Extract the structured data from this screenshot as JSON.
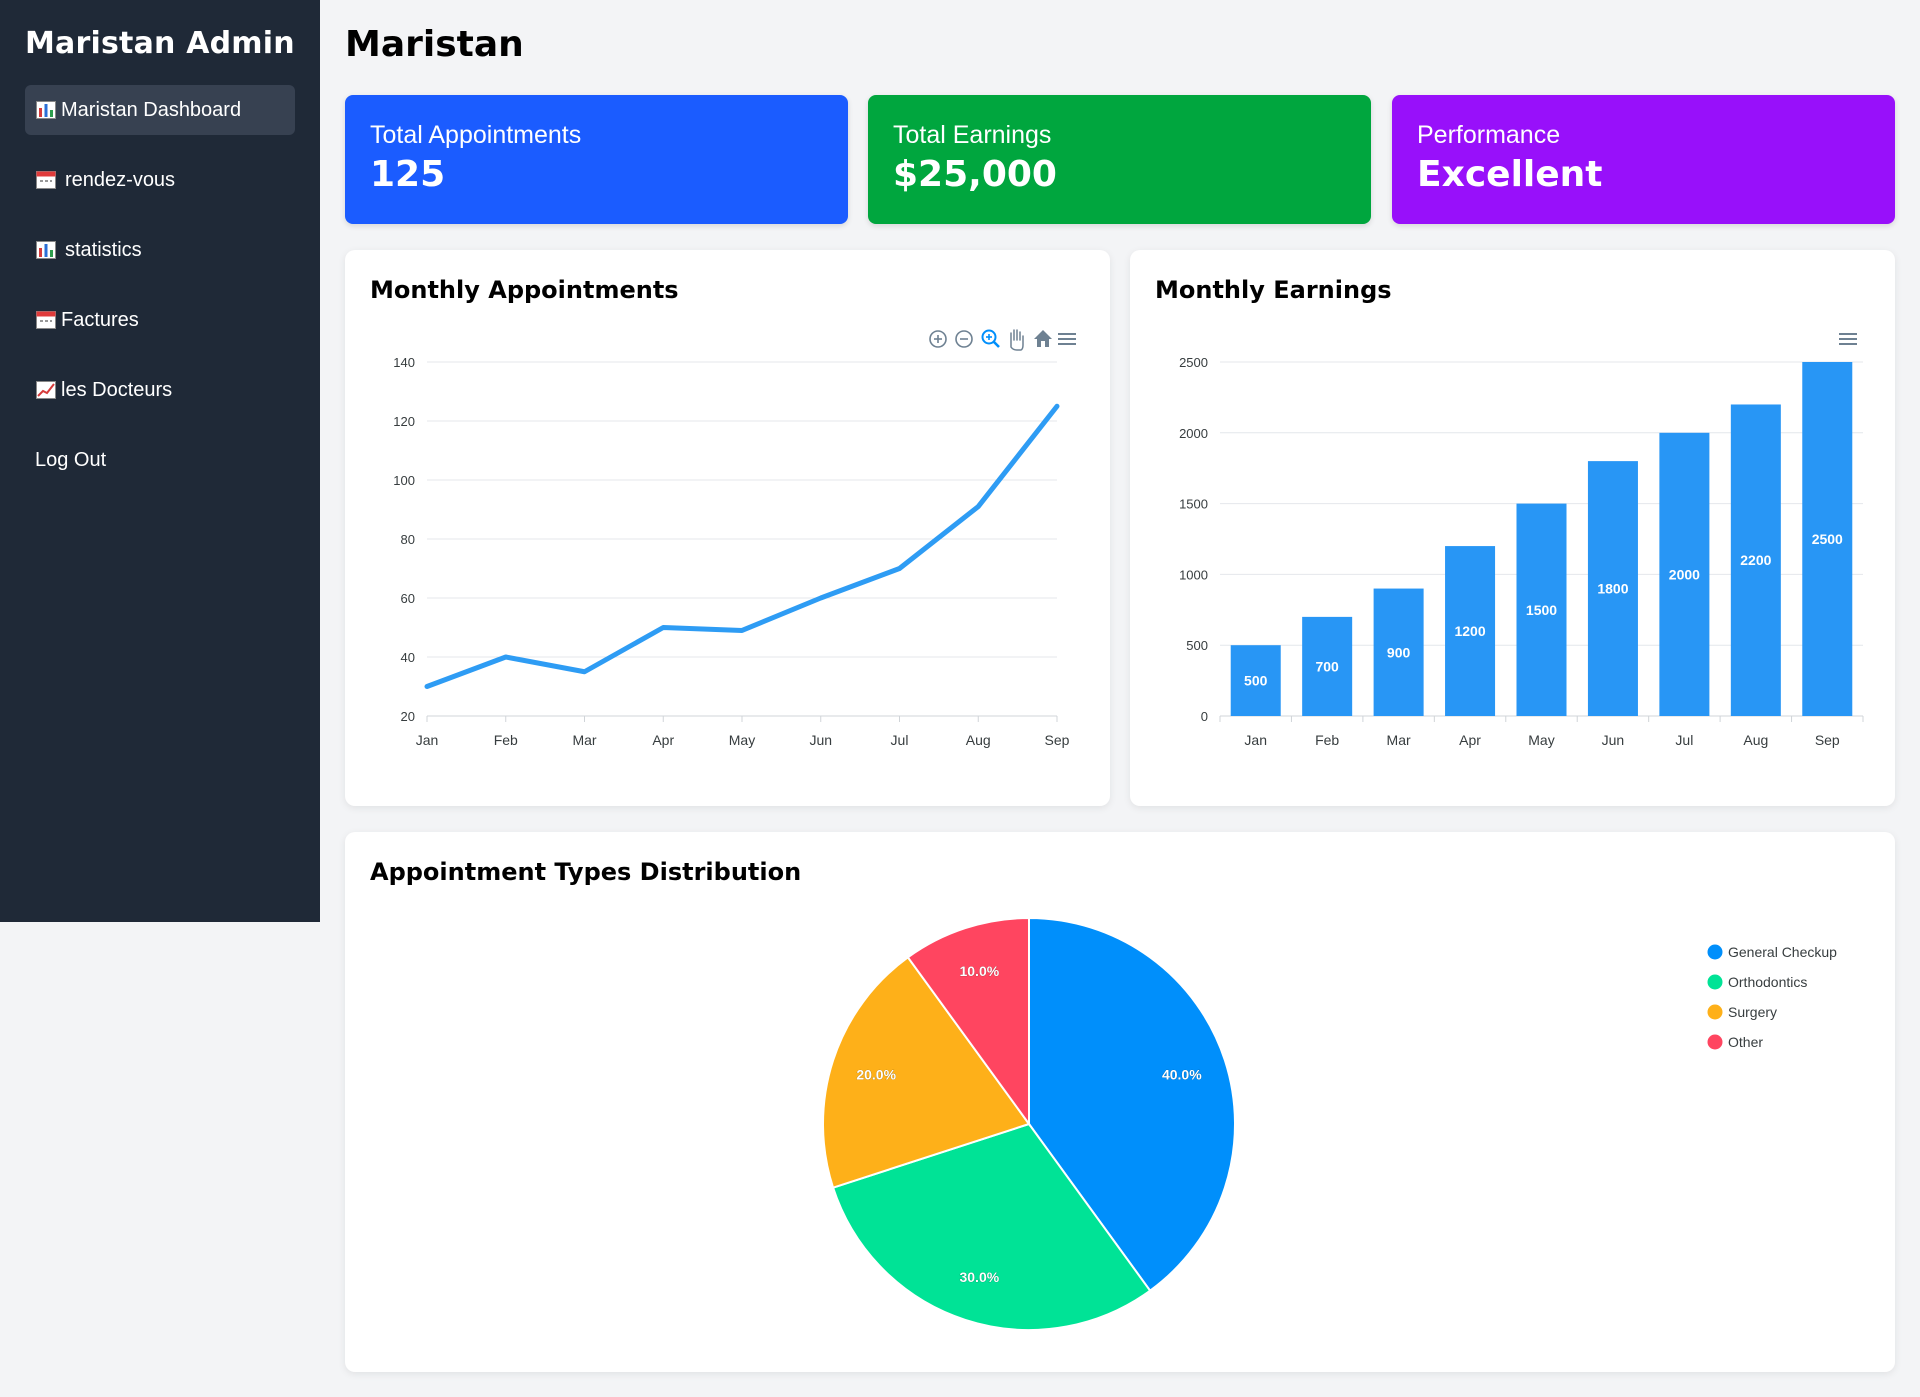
{
  "sidebar": {
    "brand": "Maristan Admin",
    "items": [
      {
        "label": "Maristan Dashboard",
        "icon": "bar-chart-icon",
        "active": true
      },
      {
        "label": "rendez-vous",
        "icon": "calendar-icon",
        "active": false
      },
      {
        "label": "statistics",
        "icon": "bar-chart-icon",
        "active": false
      },
      {
        "label": "Factures",
        "icon": "calendar-icon",
        "active": false
      },
      {
        "label": "les Docteurs",
        "icon": "trending-up-icon",
        "active": false
      },
      {
        "label": "Log Out",
        "icon": "",
        "active": false
      }
    ]
  },
  "header": {
    "title": "Maristan"
  },
  "stats": [
    {
      "label": "Total Appointments",
      "value": "125",
      "color": "#1b5cff"
    },
    {
      "label": "Total Earnings",
      "value": "$25,000",
      "color": "#00a63e"
    },
    {
      "label": "Performance",
      "value": "Excellent",
      "color": "#9810fa"
    }
  ],
  "toolbar_icons": [
    "zoom-in-icon",
    "zoom-out-icon",
    "zoom-select-icon",
    "pan-hand-icon",
    "home-reset-icon",
    "menu-icon"
  ],
  "chart_data": [
    {
      "type": "line",
      "title": "Monthly Appointments",
      "categories": [
        "Jan",
        "Feb",
        "Mar",
        "Apr",
        "May",
        "Jun",
        "Jul",
        "Aug",
        "Sep"
      ],
      "series": [
        {
          "values": [
            30,
            40,
            35,
            50,
            49,
            60,
            70,
            91,
            125
          ]
        }
      ],
      "ylim": [
        20,
        140
      ],
      "yticks": [
        20,
        40,
        60,
        80,
        100,
        120,
        140
      ],
      "grid": true,
      "color": "#2e9cf4"
    },
    {
      "type": "bar",
      "title": "Monthly Earnings",
      "categories": [
        "Jan",
        "Feb",
        "Mar",
        "Apr",
        "May",
        "Jun",
        "Jul",
        "Aug",
        "Sep"
      ],
      "values": [
        500,
        700,
        900,
        1200,
        1500,
        1800,
        2000,
        2200,
        2500
      ],
      "ylim": [
        0,
        2500
      ],
      "yticks": [
        0,
        500,
        1000,
        1500,
        2000,
        2500
      ],
      "grid": true,
      "color": "#2896f5"
    },
    {
      "type": "pie",
      "title": "Appointment Types Distribution",
      "slices": [
        {
          "label": "General Checkup",
          "value": 40,
          "text": "40.0%",
          "color": "#008ffb"
        },
        {
          "label": "Orthodontics",
          "value": 30,
          "text": "30.0%",
          "color": "#00e396"
        },
        {
          "label": "Surgery",
          "value": 20,
          "text": "20.0%",
          "color": "#feb019"
        },
        {
          "label": "Other",
          "value": 10,
          "text": "10.0%",
          "color": "#ff4560"
        }
      ],
      "legend_position": "top-right"
    }
  ]
}
